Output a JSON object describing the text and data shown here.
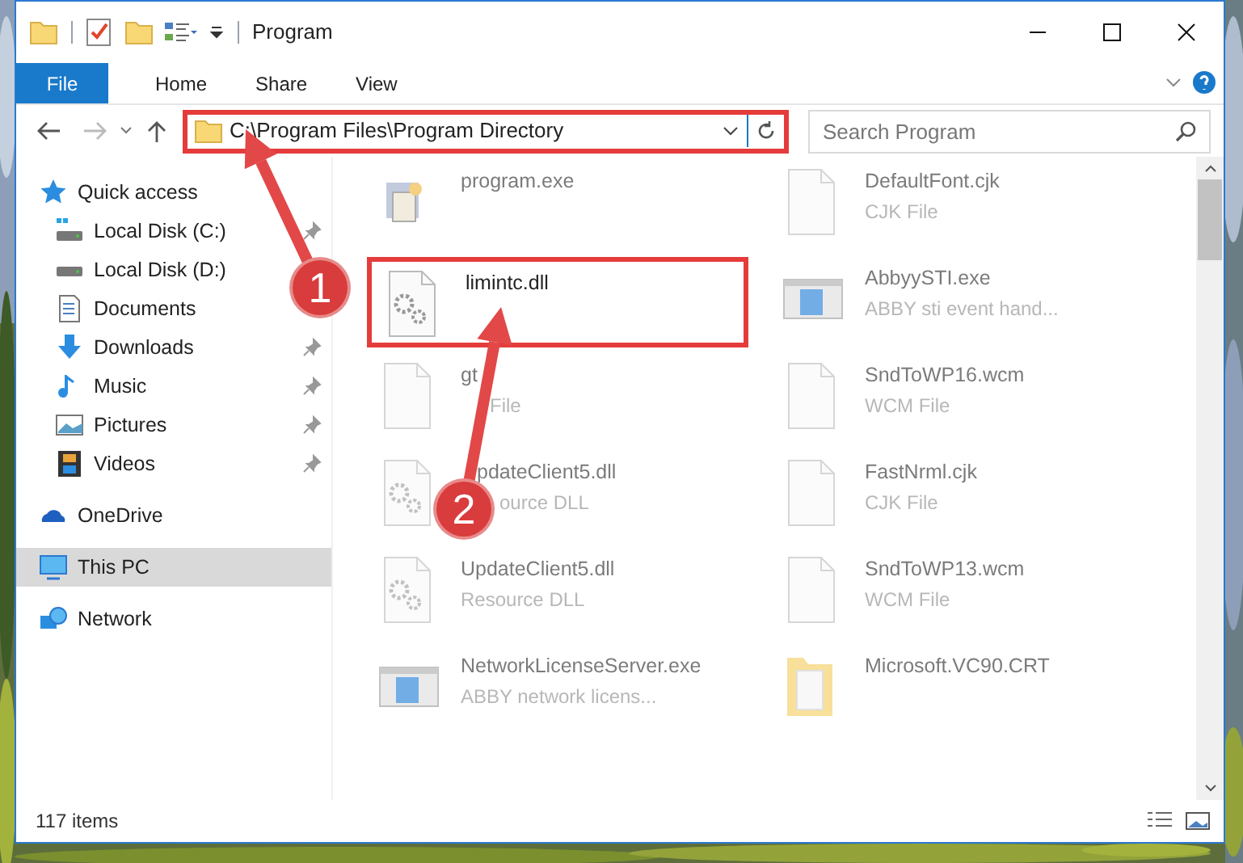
{
  "window": {
    "title": "Program"
  },
  "ribbon_tabs": [
    {
      "label": "File",
      "selected": true
    },
    {
      "label": "Home",
      "selected": false
    },
    {
      "label": "Share",
      "selected": false
    },
    {
      "label": "View",
      "selected": false
    }
  ],
  "address": {
    "value": "C:\\Program Files\\Program Directory",
    "highlighted": true
  },
  "search": {
    "placeholder": "Search Program"
  },
  "sidebar": {
    "items": [
      {
        "label": "Quick access",
        "kind": "star",
        "selected": false,
        "children": [
          {
            "label": "Local Disk (C:)",
            "kind": "system-disk",
            "pinned": true,
            "selected": false
          },
          {
            "label": "Local Disk (D:)",
            "kind": "disk",
            "pinned": false,
            "selected": false
          },
          {
            "label": "Documents",
            "kind": "documents",
            "pinned": false,
            "selected": false
          },
          {
            "label": "Downloads",
            "kind": "downloads",
            "pinned": true,
            "selected": false
          },
          {
            "label": "Music",
            "kind": "music",
            "pinned": true,
            "selected": false
          },
          {
            "label": "Pictures",
            "kind": "pictures",
            "pinned": true,
            "selected": false
          },
          {
            "label": "Videos",
            "kind": "videos",
            "pinned": true,
            "selected": false
          }
        ]
      },
      {
        "label": "OneDrive",
        "kind": "cloud",
        "selected": false
      },
      {
        "label": "This PC",
        "kind": "pc",
        "selected": true
      },
      {
        "label": "Network",
        "kind": "network",
        "selected": false
      }
    ]
  },
  "files": [
    {
      "name": "program.exe",
      "kind": "installer",
      "highlighted": false
    },
    {
      "name": "DefaultFont.cjk",
      "type": "CJK File",
      "kind": "blank",
      "highlighted": false
    },
    {
      "name": "limintc.dll",
      "kind": "dll",
      "highlighted": true
    },
    {
      "name": "AbbyySTI.exe",
      "type": "ABBY sti event hand...",
      "kind": "app",
      "highlighted": false
    },
    {
      "name": "gt",
      "type": "File",
      "kind": "blank",
      "highlighted": false
    },
    {
      "name": "SndToWP16.wcm",
      "type": "WCM File",
      "kind": "blank",
      "highlighted": false
    },
    {
      "name": "pdateClient5.dll",
      "type": "ource DLL",
      "kind": "dll",
      "highlighted": false
    },
    {
      "name": "FastNrml.cjk",
      "type": "CJK File",
      "kind": "blank",
      "highlighted": false
    },
    {
      "name": "UpdateClient5.dll",
      "type": "Resource DLL",
      "kind": "dll",
      "highlighted": false
    },
    {
      "name": "SndToWP13.wcm",
      "type": "WCM File",
      "kind": "blank",
      "highlighted": false
    },
    {
      "name": "NetworkLicenseServer.exe",
      "type": "ABBY network licens...",
      "kind": "app",
      "highlighted": false
    },
    {
      "name": "Microsoft.VC90.CRT",
      "kind": "folder",
      "highlighted": false
    }
  ],
  "callouts": [
    {
      "number": "1"
    },
    {
      "number": "2"
    }
  ],
  "status_bar": {
    "item_count": "117 items"
  }
}
